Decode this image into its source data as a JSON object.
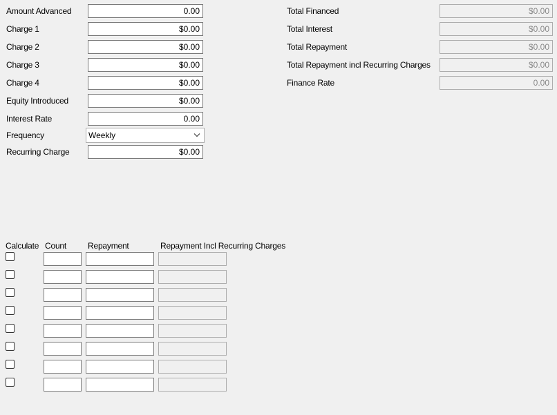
{
  "inputs": [
    {
      "label": "Amount Advanced",
      "value": "0.00"
    },
    {
      "label": "Charge 1",
      "value": "$0.00"
    },
    {
      "label": "Charge 2",
      "value": "$0.00"
    },
    {
      "label": "Charge 3",
      "value": "$0.00"
    },
    {
      "label": "Charge 4",
      "value": "$0.00"
    },
    {
      "label": "Equity Introduced",
      "value": "$0.00"
    },
    {
      "label": "Interest Rate",
      "value": "0.00"
    }
  ],
  "frequency": {
    "label": "Frequency",
    "value": "Weekly"
  },
  "recurring_charge": {
    "label": "Recurring Charge",
    "value": "$0.00"
  },
  "totals": [
    {
      "label": "Total Financed",
      "value": "$0.00"
    },
    {
      "label": "Total Interest",
      "value": "$0.00"
    },
    {
      "label": "Total Repayment",
      "value": "$0.00"
    },
    {
      "label": "Total Repayment incl Recurring Charges",
      "value": "$0.00"
    },
    {
      "label": "Finance Rate",
      "value": "0.00"
    }
  ],
  "table": {
    "headers": {
      "calculate": "Calculate",
      "count": "Count",
      "repayment": "Repayment",
      "repayment_incl": "Repayment Incl Recurring Charges"
    }
  },
  "icons": {
    "dropdown": "chevron-down-icon"
  }
}
